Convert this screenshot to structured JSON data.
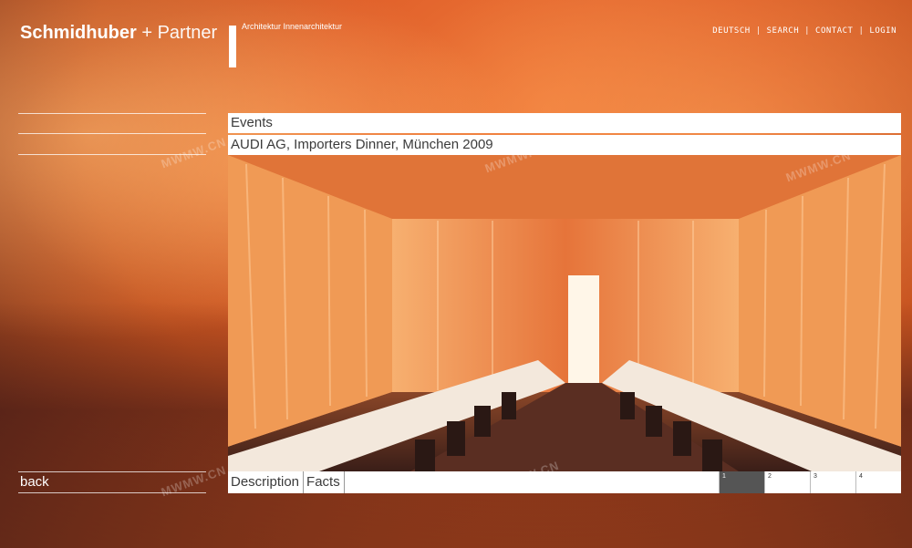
{
  "header": {
    "logo_bold": "Schmidhuber",
    "logo_plus": " + Partner",
    "tagline": "Architektur  Innenarchitektur"
  },
  "topnav": {
    "items": [
      "DEUTSCH",
      "SEARCH",
      "CONTACT",
      "LOGIN"
    ],
    "separator": "|"
  },
  "section": {
    "category": "Events",
    "project_title": "AUDI AG, Importers Dinner, München 2009"
  },
  "tabs": {
    "description": "Description",
    "facts": "Facts"
  },
  "pages": {
    "items": [
      "1",
      "2",
      "3",
      "4"
    ],
    "active": "1"
  },
  "sidebar": {
    "back_label": "back"
  },
  "watermarks": [
    "MWMW.CN",
    "MWMW.CN",
    "MWMW.CN",
    "MWMW.CN",
    "MWMW.CN"
  ],
  "colors": {
    "accent_orange": "#e8682e",
    "bar_white": "#ffffff",
    "text_dark": "#3b3b3b",
    "active_page": "#555555"
  }
}
